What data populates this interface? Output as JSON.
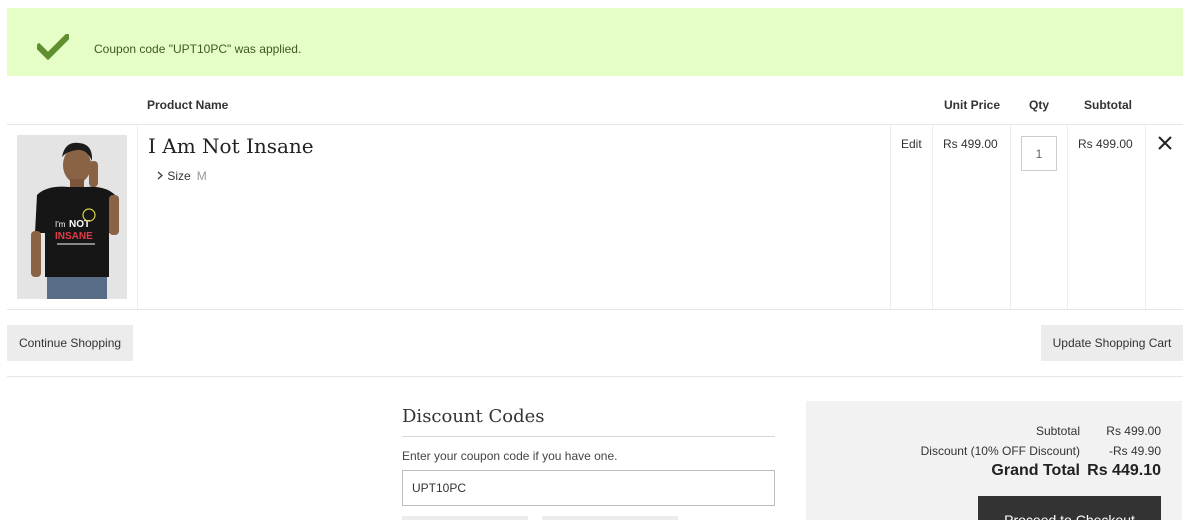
{
  "messages": {
    "success_text": "Coupon code \"UPT10PC\" was applied.",
    "icon": "check-icon",
    "color": "#e5fec6"
  },
  "cart": {
    "headers": {
      "product_name": "Product Name",
      "unit_price": "Unit Price",
      "qty": "Qty",
      "subtotal": "Subtotal"
    },
    "items": [
      {
        "name": "I Am Not Insane",
        "options": [
          {
            "label": "Size",
            "value": "M"
          }
        ],
        "edit_label": "Edit",
        "unit_price": "Rs 499.00",
        "qty": "1",
        "subtotal": "Rs 499.00",
        "image_text": {
          "line1": "I'm",
          "line2": "NOT",
          "line3": "INSANE"
        }
      }
    ],
    "continue_label": "Continue Shopping",
    "update_label": "Update Shopping Cart"
  },
  "discount": {
    "title": "Discount Codes",
    "help": "Enter your coupon code if you have one.",
    "value": "UPT10PC"
  },
  "totals": {
    "subtotal_label": "Subtotal",
    "subtotal_value": "Rs 499.00",
    "discount_label": "Discount (10% OFF Discount)",
    "discount_value": "-Rs 49.90",
    "grand_label": "Grand Total",
    "grand_value": "Rs 449.10",
    "checkout_label": "Proceed to Checkout"
  }
}
